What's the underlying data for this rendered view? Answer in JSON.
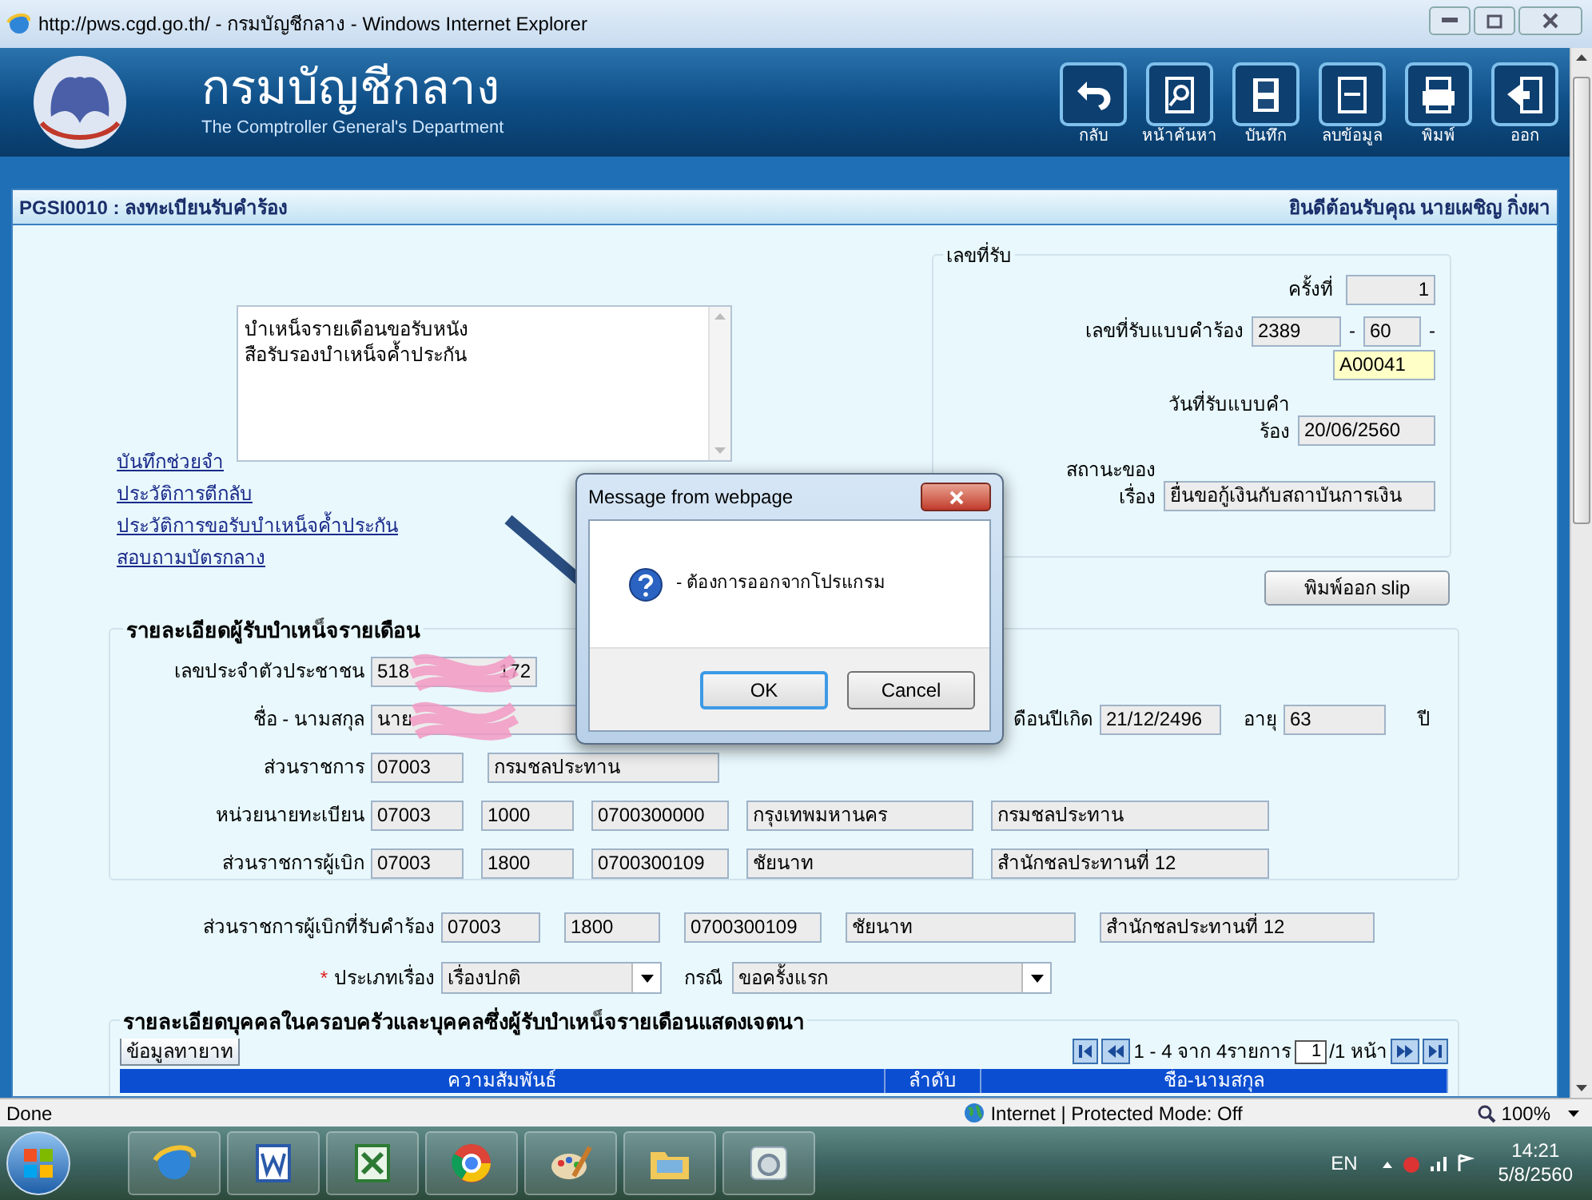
{
  "browser": {
    "title": "http://pws.cgd.go.th/ - กรมบัญชีกลาง - Windows Internet Explorer",
    "status": "Done",
    "zone": "Internet | Protected Mode: Off",
    "zoom": "100%"
  },
  "header": {
    "title": "กรมบัญชีกลาง",
    "subtitle": "The Comptroller General's Department",
    "toolbar": [
      {
        "kind": "back",
        "label": "กลับ"
      },
      {
        "kind": "search",
        "label": "หน้าค้นหา"
      },
      {
        "kind": "save",
        "label": "บันทึก"
      },
      {
        "kind": "delete",
        "label": "ลบข้อมูล"
      },
      {
        "kind": "print",
        "label": "พิมพ์"
      },
      {
        "kind": "exit",
        "label": "ออก"
      }
    ]
  },
  "page": {
    "title": "PGSI0010 : ลงทะเบียนรับคำร้อง",
    "welcome": "ยินดีต้อนรับคุณ นายเผชิญ กิ่งผา"
  },
  "memo": {
    "value": "บำเหน็จรายเดือนขอรับหนัง\nสือรับรองบำเหน็จค้ำประกัน"
  },
  "links": [
    "บันทึกช่วยจำ",
    "ประวัติการตีกลับ",
    "ประวัติการขอรับบำเหน็จค้ำประกัน",
    "สอบถามบัตรกลาง"
  ],
  "receipt": {
    "legend": "เลขที่รับ",
    "round": {
      "label": "ครั้งที่",
      "value": "1"
    },
    "number": {
      "label": "เลขที่รับแบบคำร้อง",
      "parts": [
        "2389",
        "60",
        "A00041"
      ],
      "separators": [
        "-",
        "-"
      ]
    },
    "date": {
      "label_lines": [
        "วันที่รับแบบคำ",
        "ร้อง"
      ],
      "value": "20/06/2560"
    },
    "status": {
      "label_lines": [
        "สถานะของ",
        "เรื่อง"
      ],
      "value": "ยื่นขอกู้เงินกับสถาบันการเงิน"
    }
  },
  "print_button": "พิมพ์ออก slip",
  "pensioner": {
    "legend": "รายละเอียดผู้รับบำเหน็จรายเดือน",
    "id": {
      "label": "เลขประจำตัวประชาชน",
      "visible_start": "518",
      "visible_end": "172",
      "redacted": true
    },
    "name": {
      "label": "ชื่อ - นามสกุล",
      "visible": "นาย",
      "redacted": true
    },
    "birth": {
      "label": "ดือนปีเกิด",
      "value": "21/12/2496"
    },
    "age": {
      "label": "อายุ",
      "value": "63",
      "unit": "ปี"
    },
    "agency": {
      "label": "ส่วนราชการ",
      "values": [
        "07003",
        "กรมชลประทาน"
      ]
    },
    "registrar": {
      "label": "หน่วยนายทะเบียน",
      "values": [
        "07003",
        "1000",
        "0700300000",
        "กรุงเทพมหานคร",
        "กรมชลประทาน"
      ]
    },
    "disburser": {
      "label": "ส่วนราชการผู้เบิก",
      "values": [
        "07003",
        "1800",
        "0700300109",
        "ชัยนาท",
        "สำนักชลประทานที่ 12"
      ]
    }
  },
  "request_agency": {
    "label": "ส่วนราชการผู้เบิกที่รับคำร้อง",
    "values": [
      "07003",
      "1800",
      "0700300109",
      "ชัยนาท",
      "สำนักชลประทานที่ 12"
    ]
  },
  "case_type": {
    "required_mark": "*",
    "label": "ประเภทเรื่อง",
    "value": "เรื่องปกติ"
  },
  "case": {
    "label": "กรณี",
    "value": "ขอครั้งแรก"
  },
  "family": {
    "legend": "รายละเอียดบุคคลในครอบครัวและบุคคลซึ่งผู้รับบำเหน็จรายเดือนแสดงเจตนา",
    "tab": "ข้อมูลทายาท",
    "pager": {
      "summary": "1 - 4 จาก 4รายการ",
      "page": "1",
      "total": "/1 หน้า"
    },
    "columns": [
      "ความสัมพันธ์",
      "ลำดับ",
      "ชื่อ-นามสกุล"
    ]
  },
  "dialog": {
    "title": "Message from webpage",
    "message": "- ต้องการออกจากโปรแกรม",
    "buttons": [
      {
        "label": "OK",
        "focused": true
      },
      {
        "label": "Cancel",
        "focused": false
      }
    ]
  },
  "taskbar": {
    "apps": [
      {
        "kind": "ie"
      },
      {
        "kind": "word"
      },
      {
        "kind": "excel"
      },
      {
        "kind": "chrome"
      },
      {
        "kind": "paint"
      },
      {
        "kind": "folder"
      },
      {
        "kind": "camera"
      }
    ],
    "language": "EN",
    "time": "14:21",
    "date": "5/8/2560"
  }
}
